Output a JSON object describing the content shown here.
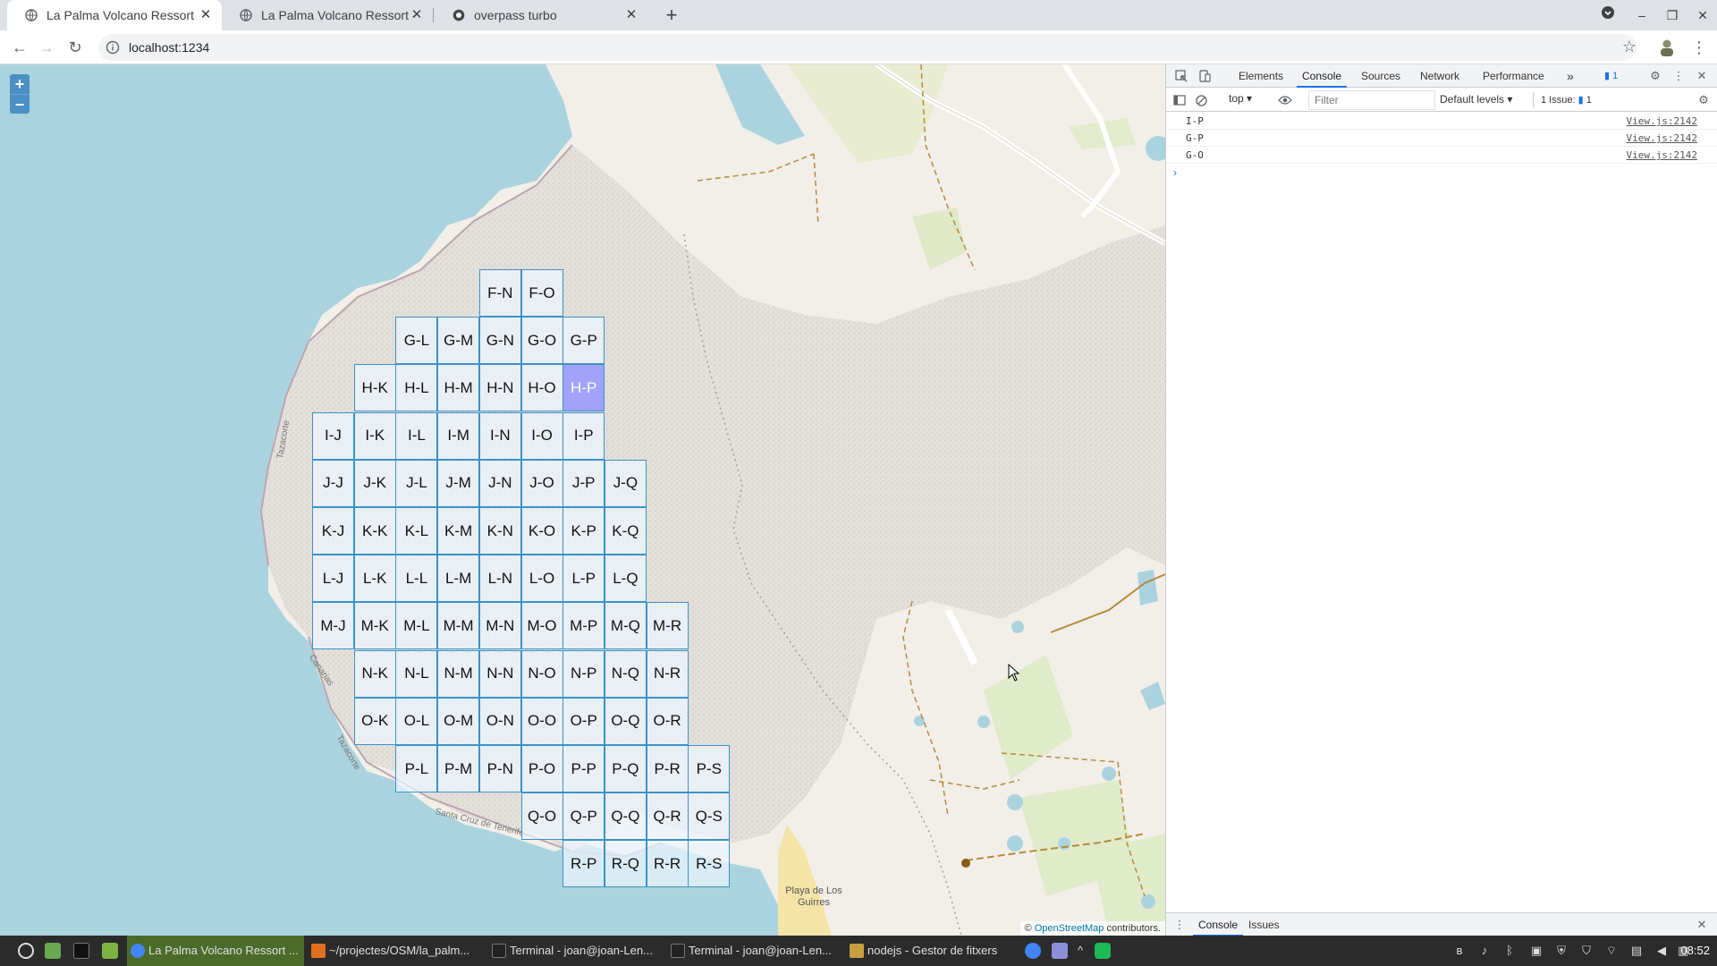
{
  "browser": {
    "tabs": [
      {
        "title": "La Palma Volcano Ressort",
        "active": true
      },
      {
        "title": "La Palma Volcano Ressort - w",
        "active": false
      },
      {
        "title": "overpass turbo",
        "active": false
      }
    ],
    "url": "localhost:1234"
  },
  "map": {
    "zoom_in": "+",
    "zoom_out": "−",
    "attribution_prefix": "©",
    "attribution_link": "OpenStreetMap",
    "attribution_suffix": "contributors.",
    "labels": {
      "beach": "Playa de Los Guirres",
      "road1": "Tazacorte",
      "road2": "Canarias",
      "road3": "Tazacorte",
      "road4": "Santa Cruz de Tenerife"
    },
    "grid_rows": [
      {
        "row": "F",
        "cols": [
          "N",
          "O"
        ]
      },
      {
        "row": "G",
        "cols": [
          "L",
          "M",
          "N",
          "O",
          "P"
        ]
      },
      {
        "row": "H",
        "cols": [
          "K",
          "L",
          "M",
          "N",
          "O",
          "P"
        ]
      },
      {
        "row": "I",
        "cols": [
          "J",
          "K",
          "L",
          "M",
          "N",
          "O",
          "P"
        ]
      },
      {
        "row": "J",
        "cols": [
          "J",
          "K",
          "L",
          "M",
          "N",
          "O",
          "P",
          "Q"
        ]
      },
      {
        "row": "K",
        "cols": [
          "J",
          "K",
          "L",
          "M",
          "N",
          "O",
          "P",
          "Q"
        ]
      },
      {
        "row": "L",
        "cols": [
          "J",
          "K",
          "L",
          "M",
          "N",
          "O",
          "P",
          "Q"
        ]
      },
      {
        "row": "M",
        "cols": [
          "J",
          "K",
          "L",
          "M",
          "N",
          "O",
          "P",
          "Q",
          "R"
        ]
      },
      {
        "row": "N",
        "cols": [
          "K",
          "L",
          "M",
          "N",
          "O",
          "P",
          "Q",
          "R"
        ]
      },
      {
        "row": "O",
        "cols": [
          "K",
          "L",
          "M",
          "N",
          "O",
          "P",
          "Q",
          "R"
        ]
      },
      {
        "row": "P",
        "cols": [
          "L",
          "M",
          "N",
          "O",
          "P",
          "Q",
          "R",
          "S"
        ]
      },
      {
        "row": "Q",
        "cols": [
          "O",
          "P",
          "Q",
          "R",
          "S"
        ]
      },
      {
        "row": "R",
        "cols": [
          "P",
          "Q",
          "R",
          "S"
        ]
      }
    ],
    "selected_cell": "H-P"
  },
  "devtools": {
    "tabs": [
      "Elements",
      "Console",
      "Sources",
      "Network",
      "Performance"
    ],
    "active_tab": "Console",
    "more": "»",
    "issues_badge": "1",
    "context": "top",
    "filter_placeholder": "Filter",
    "levels": "Default levels",
    "issues_label": "1 Issue:",
    "issues_count": "1",
    "logs": [
      {
        "msg": "I-P",
        "src": "View.js:2142"
      },
      {
        "msg": "G-P",
        "src": "View.js:2142"
      },
      {
        "msg": "G-O",
        "src": "View.js:2142"
      }
    ],
    "prompt": "›",
    "drawer_tabs": [
      "Console",
      "Issues"
    ]
  },
  "taskbar": {
    "items": [
      {
        "label": "La Palma Volcano Ressort ...",
        "active": true,
        "color": "#4285f4"
      },
      {
        "label": "~/projectes/OSM/la_palm...",
        "active": false,
        "color": "#e07020"
      },
      {
        "label": "Terminal - joan@joan-Len...",
        "active": false,
        "color": "#222"
      },
      {
        "label": "Terminal - joan@joan-Len...",
        "active": false,
        "color": "#222"
      },
      {
        "label": "nodejs - Gestor de fitxers",
        "active": false,
        "color": "#c8a040"
      }
    ],
    "clock": "08:52"
  }
}
